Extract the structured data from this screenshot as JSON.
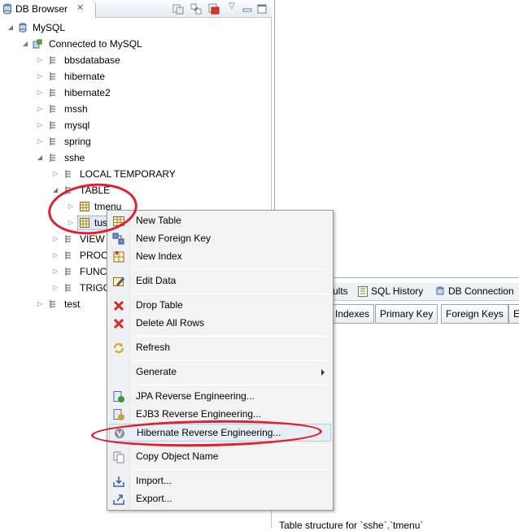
{
  "view": {
    "title": "DB Browser",
    "close_glyph": "✕"
  },
  "tree": [
    {
      "label": "MySQL",
      "icon": "database-icon"
    },
    {
      "label": "Connected to MySQL",
      "icon": "connection-icon"
    },
    {
      "label": "bbsdatabase",
      "icon": "schema-icon"
    },
    {
      "label": "hibernate",
      "icon": "schema-icon"
    },
    {
      "label": "hibernate2",
      "icon": "schema-icon"
    },
    {
      "label": "mssh",
      "icon": "schema-icon"
    },
    {
      "label": "mysql",
      "icon": "schema-icon"
    },
    {
      "label": "spring",
      "icon": "schema-icon"
    },
    {
      "label": "sshe",
      "icon": "schema-icon"
    },
    {
      "label": "LOCAL TEMPORARY",
      "icon": "folder-node-icon"
    },
    {
      "label": "TABLE",
      "icon": "folder-node-icon"
    },
    {
      "label": "tmenu",
      "icon": "table-icon"
    },
    {
      "label": "tus",
      "icon": "table-icon"
    },
    {
      "label": "VIEW",
      "icon": "folder-node-icon"
    },
    {
      "label": "PROC",
      "icon": "folder-node-icon"
    },
    {
      "label": "FUNC",
      "icon": "folder-node-icon"
    },
    {
      "label": "TRIGG",
      "icon": "folder-node-icon"
    },
    {
      "label": "test",
      "icon": "schema-icon"
    }
  ],
  "bottom_panel": {
    "tabs": [
      "ults",
      "SQL History",
      "DB Connection"
    ],
    "column_tabs": [
      "Indexes",
      "Primary Key",
      "Foreign Keys",
      "E"
    ],
    "structure_label": "Table structure for `sshe`.`tmenu`"
  },
  "context_menu": {
    "items": [
      {
        "label": "New Table",
        "icon": "table-icon"
      },
      {
        "label": "New Foreign Key",
        "icon": "foreign-key-icon"
      },
      {
        "label": "New Index",
        "icon": "index-icon"
      },
      {
        "label": "Edit Data",
        "icon": "edit-icon"
      },
      {
        "label": "Drop Table",
        "icon": "red-x-icon"
      },
      {
        "label": "Delete All Rows",
        "icon": "red-x-icon"
      },
      {
        "label": "Refresh",
        "icon": "refresh-icon"
      },
      {
        "label": "Generate",
        "icon": ""
      },
      {
        "label": "JPA Reverse Engineering...",
        "icon": "jpa-icon"
      },
      {
        "label": "EJB3 Reverse Engineering...",
        "icon": "ejb3-icon"
      },
      {
        "label": "Hibernate Reverse Engineering...",
        "icon": "hibernate-icon"
      },
      {
        "label": "Copy Object Name",
        "icon": "copy-icon"
      },
      {
        "label": "Import...",
        "icon": "import-icon"
      },
      {
        "label": "Export...",
        "icon": "export-icon"
      }
    ]
  },
  "colors": {
    "annotation": "#e0202a",
    "menu_bg": "#f3f3f3",
    "highlight": "#e8eef8"
  }
}
